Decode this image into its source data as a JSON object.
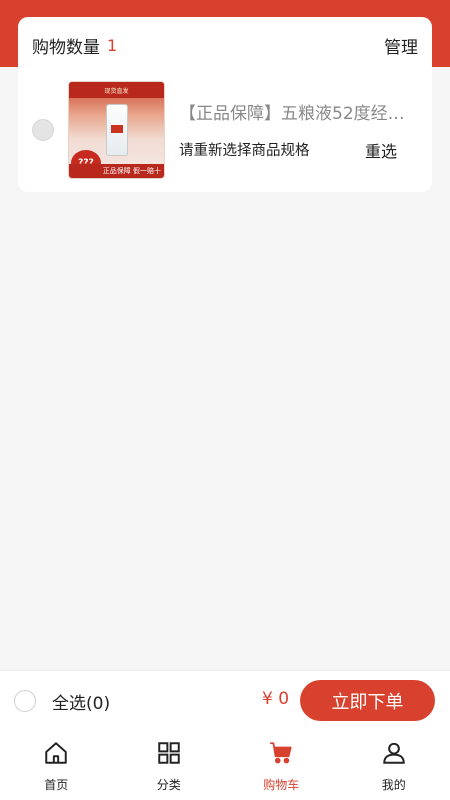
{
  "cart": {
    "count_label": "购物数量",
    "count": "1",
    "manage_label": "管理"
  },
  "item": {
    "title": "【正品保障】五粮液52度经…",
    "spec_prompt": "请重新选择商品规格",
    "reselect_label": "重选",
    "thumb": {
      "banner_text": "现货直发",
      "question_text": "???",
      "strip_text": "正品保障 假一赔十"
    }
  },
  "checkout": {
    "select_all_label": "全选(0)",
    "total": "¥ 0",
    "order_label": "立即下单"
  },
  "tabs": [
    {
      "label": "首页",
      "icon": "home-icon",
      "active": false
    },
    {
      "label": "分类",
      "icon": "grid-icon",
      "active": false
    },
    {
      "label": "购物车",
      "icon": "cart-icon",
      "active": true
    },
    {
      "label": "我的",
      "icon": "user-icon",
      "active": false
    }
  ],
  "colors": {
    "accent": "#d9412f",
    "background": "#f5f5f5"
  }
}
